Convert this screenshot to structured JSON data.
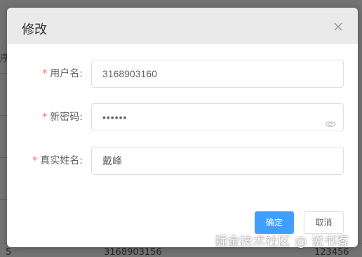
{
  "background": {
    "left_fragment": "序",
    "row": {
      "index": "5",
      "username": "3168903156",
      "password": "123456"
    }
  },
  "dialog": {
    "title": "修改",
    "close_icon": "close-icon",
    "fields": {
      "username": {
        "label": "用户名:",
        "value": "3168903160"
      },
      "password": {
        "label": "新密码:",
        "value": "••••••",
        "icon": "eye-icon"
      },
      "realname": {
        "label": "真实姓名:",
        "value": "戴峰"
      }
    },
    "required_mark": "*",
    "buttons": {
      "confirm": "确定",
      "cancel": "取消"
    }
  },
  "watermark": "掘金技术社区 @ 说书客",
  "colors": {
    "primary": "#409eff",
    "required": "#f56c6c",
    "header_bg": "#eaeaea",
    "overlay": "#737373"
  }
}
